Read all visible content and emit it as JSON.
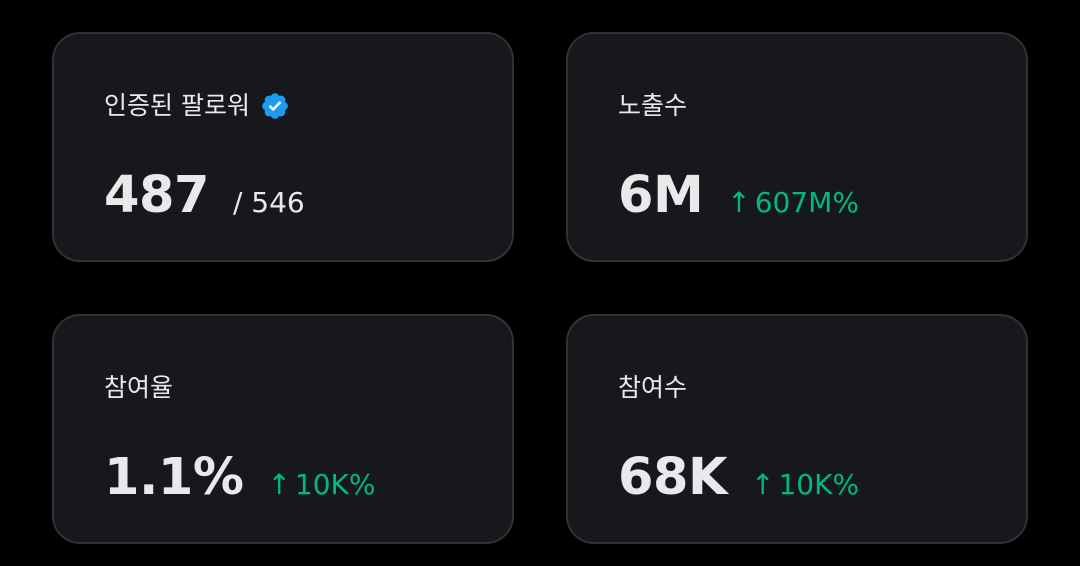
{
  "colors": {
    "background": "#000000",
    "card_background": "#16181c",
    "card_border": "#2f3336",
    "text_primary": "#e7e9ea",
    "positive": "#00ba7c",
    "verified_badge": "#1d9bf0"
  },
  "cards": [
    {
      "label": "인증된 팔로워",
      "icon": "verified-badge-icon",
      "value": "487",
      "sub": "/ 546"
    },
    {
      "label": "노출수",
      "value": "6M",
      "change_arrow": "↑",
      "change": "607M%"
    },
    {
      "label": "참여율",
      "value": "1.1%",
      "change_arrow": "↑",
      "change": "10K%"
    },
    {
      "label": "참여수",
      "value": "68K",
      "change_arrow": "↑",
      "change": "10K%"
    }
  ]
}
